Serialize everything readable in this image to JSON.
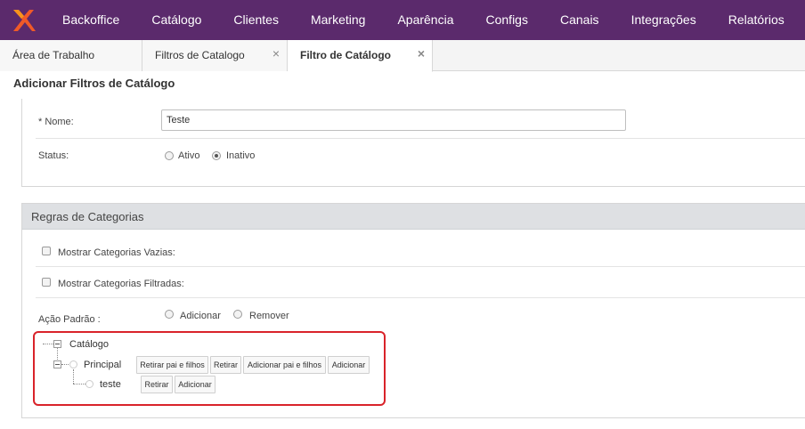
{
  "topnav": {
    "logo_icon": "x-logo-icon",
    "brand_color": "#5b2a6c",
    "items": [
      "Backoffice",
      "Catálogo",
      "Clientes",
      "Marketing",
      "Aparência",
      "Configs",
      "Canais",
      "Integrações",
      "Relatórios"
    ]
  },
  "tabs": [
    {
      "label": "Área de Trabalho"
    },
    {
      "label": "Filtros de Catalogo",
      "close": "×"
    },
    {
      "label": "Filtro de Catálogo",
      "close": "×"
    }
  ],
  "page": {
    "title": "Adicionar Filtros de Catálogo"
  },
  "form": {
    "name_label": "* Nome:",
    "name_value": "Teste",
    "status_label": "Status:",
    "status_options": [
      "Ativo",
      "Inativo"
    ],
    "status_selected": "Inativo"
  },
  "rules": {
    "header": "Regras de Categorias",
    "show_empty_label": "Mostrar Categorias Vazias:",
    "show_filtered_label": "Mostrar Categorias Filtradas:",
    "default_action_label": "Ação Padrão :",
    "default_action_options": [
      "Adicionar",
      "Remover"
    ]
  },
  "tree": {
    "highlight_color": "#d9232a",
    "root": "Catálogo",
    "child": "Principal",
    "child_buttons": [
      "Retirar pai e filhos",
      "Retirar",
      "Adicionar pai e filhos",
      "Adicionar"
    ],
    "grandchild": "teste",
    "grandchild_buttons": [
      "Retirar",
      "Adicionar"
    ]
  }
}
